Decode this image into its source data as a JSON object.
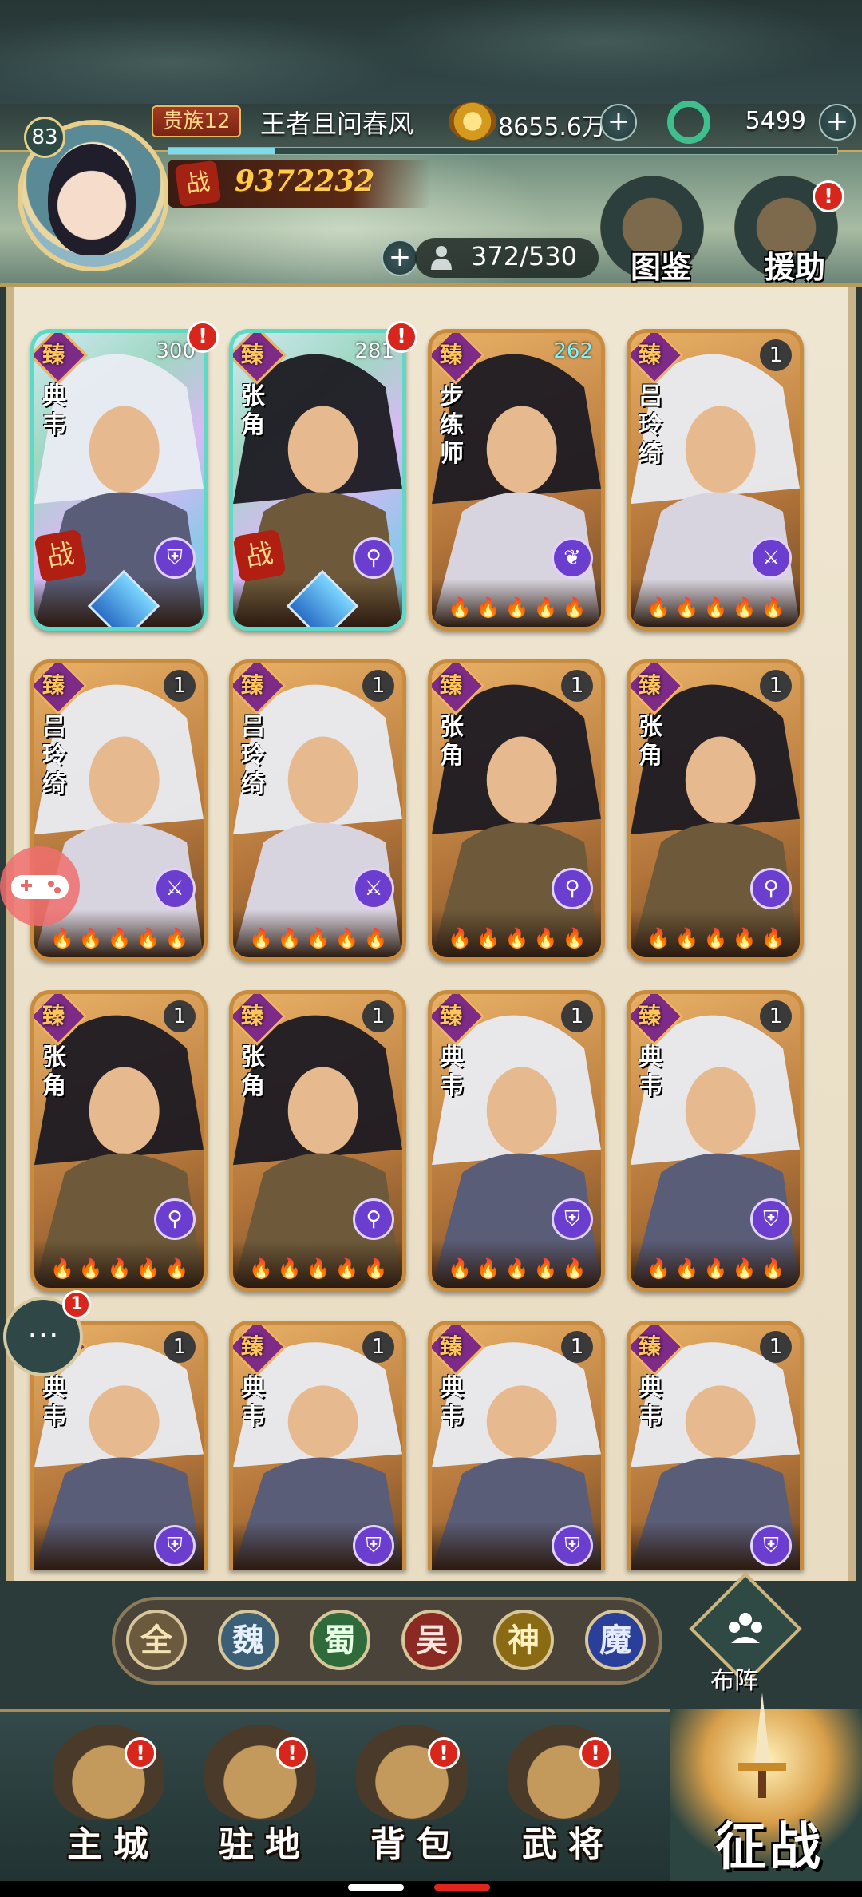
{
  "player": {
    "level": "83",
    "noble_rank": "贵族12",
    "name": "王者且问春风",
    "power_badge": "战",
    "power": "9372232",
    "xp_fraction": 0.16
  },
  "currency": {
    "gold": "8655.6万",
    "jade": "5499",
    "plus": "+"
  },
  "roster": {
    "capacity": "372/530",
    "plus": "+"
  },
  "side_buttons": {
    "codex": "图鉴",
    "support": "援助",
    "support_badge": "!"
  },
  "cards": [
    {
      "name": "典韦",
      "count": "300",
      "rarity": "臻",
      "class_icon": "shield-icon",
      "class_glyph": "⛨",
      "style": "holo",
      "badge": "!",
      "in_battle": true,
      "battle_label": "战",
      "stars": ""
    },
    {
      "name": "张角",
      "count": "281",
      "rarity": "臻",
      "class_icon": "staff-icon",
      "class_glyph": "⚲",
      "style": "holo",
      "badge": "!",
      "in_battle": true,
      "battle_label": "战",
      "stars": ""
    },
    {
      "name": "步练师",
      "count": "262",
      "rarity": "臻",
      "class_icon": "leaf-icon",
      "class_glyph": "❦",
      "style": "gold",
      "badge": "",
      "in_battle": false,
      "stars": "🔥🔥🔥🔥🔥"
    },
    {
      "name": "吕玲绮",
      "count": "1",
      "rarity": "臻",
      "class_icon": "spear-icon",
      "class_glyph": "⚔",
      "style": "gold",
      "badge": "",
      "in_battle": false,
      "stars": "🔥🔥🔥🔥🔥"
    },
    {
      "name": "吕玲绮",
      "count": "1",
      "rarity": "臻",
      "class_icon": "spear-icon",
      "class_glyph": "⚔",
      "style": "gold",
      "badge": "",
      "in_battle": false,
      "stars": "🔥🔥🔥🔥🔥"
    },
    {
      "name": "吕玲绮",
      "count": "1",
      "rarity": "臻",
      "class_icon": "spear-icon",
      "class_glyph": "⚔",
      "style": "gold",
      "badge": "",
      "in_battle": false,
      "stars": "🔥🔥🔥🔥🔥"
    },
    {
      "name": "张角",
      "count": "1",
      "rarity": "臻",
      "class_icon": "staff-icon",
      "class_glyph": "⚲",
      "style": "gold",
      "badge": "",
      "in_battle": false,
      "stars": "🔥🔥🔥🔥🔥"
    },
    {
      "name": "张角",
      "count": "1",
      "rarity": "臻",
      "class_icon": "staff-icon",
      "class_glyph": "⚲",
      "style": "gold",
      "badge": "",
      "in_battle": false,
      "stars": "🔥🔥🔥🔥🔥"
    },
    {
      "name": "张角",
      "count": "1",
      "rarity": "臻",
      "class_icon": "staff-icon",
      "class_glyph": "⚲",
      "style": "gold",
      "badge": "",
      "in_battle": false,
      "stars": "🔥🔥🔥🔥🔥"
    },
    {
      "name": "张角",
      "count": "1",
      "rarity": "臻",
      "class_icon": "staff-icon",
      "class_glyph": "⚲",
      "style": "gold",
      "badge": "",
      "in_battle": false,
      "stars": "🔥🔥🔥🔥🔥"
    },
    {
      "name": "典韦",
      "count": "1",
      "rarity": "臻",
      "class_icon": "shield-icon",
      "class_glyph": "⛨",
      "style": "gold",
      "badge": "",
      "in_battle": false,
      "stars": "🔥🔥🔥🔥🔥"
    },
    {
      "name": "典韦",
      "count": "1",
      "rarity": "臻",
      "class_icon": "shield-icon",
      "class_glyph": "⛨",
      "style": "gold",
      "badge": "",
      "in_battle": false,
      "stars": "🔥🔥🔥🔥🔥"
    },
    {
      "name": "典韦",
      "count": "1",
      "rarity": "臻",
      "class_icon": "shield-icon",
      "class_glyph": "⛨",
      "style": "gold",
      "badge": "",
      "in_battle": false,
      "stars": ""
    },
    {
      "name": "典韦",
      "count": "1",
      "rarity": "臻",
      "class_icon": "shield-icon",
      "class_glyph": "⛨",
      "style": "gold",
      "badge": "",
      "in_battle": false,
      "stars": ""
    },
    {
      "name": "典韦",
      "count": "1",
      "rarity": "臻",
      "class_icon": "shield-icon",
      "class_glyph": "⛨",
      "style": "gold",
      "badge": "",
      "in_battle": false,
      "stars": ""
    },
    {
      "name": "典韦",
      "count": "1",
      "rarity": "臻",
      "class_icon": "shield-icon",
      "class_glyph": "⛨",
      "style": "gold",
      "badge": "",
      "in_battle": false,
      "stars": ""
    }
  ],
  "factions": [
    {
      "label": "全",
      "color": "#6b5a3e",
      "text": "#f5e3b3"
    },
    {
      "label": "魏",
      "color": "#3c5f78",
      "text": "#e6f0ff"
    },
    {
      "label": "蜀",
      "color": "#2f6a3a",
      "text": "#e8ffe6"
    },
    {
      "label": "吴",
      "color": "#8a2a22",
      "text": "#ffe6e0"
    },
    {
      "label": "神",
      "color": "#8a6a12",
      "text": "#fff2c0"
    },
    {
      "label": "魔",
      "color": "#2a3f9a",
      "text": "#e6ecff"
    }
  ],
  "formation": {
    "label": "布阵"
  },
  "nav": {
    "items": [
      {
        "label": "主城",
        "icon": "city-icon",
        "badge": "!"
      },
      {
        "label": "驻地",
        "icon": "garrison-icon",
        "badge": "!"
      },
      {
        "label": "背包",
        "icon": "backpack-icon",
        "badge": "!"
      },
      {
        "label": "武将",
        "icon": "general-icon",
        "badge": "!"
      }
    ],
    "battle": "征战"
  },
  "chat": {
    "badge": "1",
    "glyph": "⋯"
  },
  "colors": {
    "accent_gold": "#e6cf88",
    "badge_red": "#d8261c",
    "class_purple": "#6b3ed0"
  }
}
